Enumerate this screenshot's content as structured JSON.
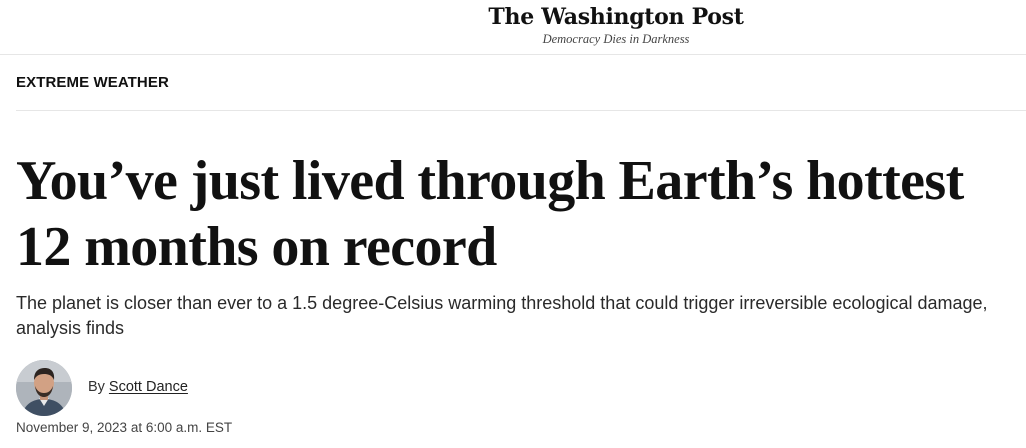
{
  "masthead": {
    "logo": "The Washington Post",
    "tagline": "Democracy Dies in Darkness"
  },
  "article": {
    "section": "EXTREME WEATHER",
    "headline": "You’ve just lived through Earth’s hottest 12 months on record",
    "subheadline": "The planet is closer than ever to a 1.5 degree-Celsius warming threshold that could trigger irreversible ecological damage, analysis finds",
    "byline_prefix": "By",
    "author": "Scott Dance",
    "date": "November 9, 2023 at 6:00 a.m. EST"
  }
}
